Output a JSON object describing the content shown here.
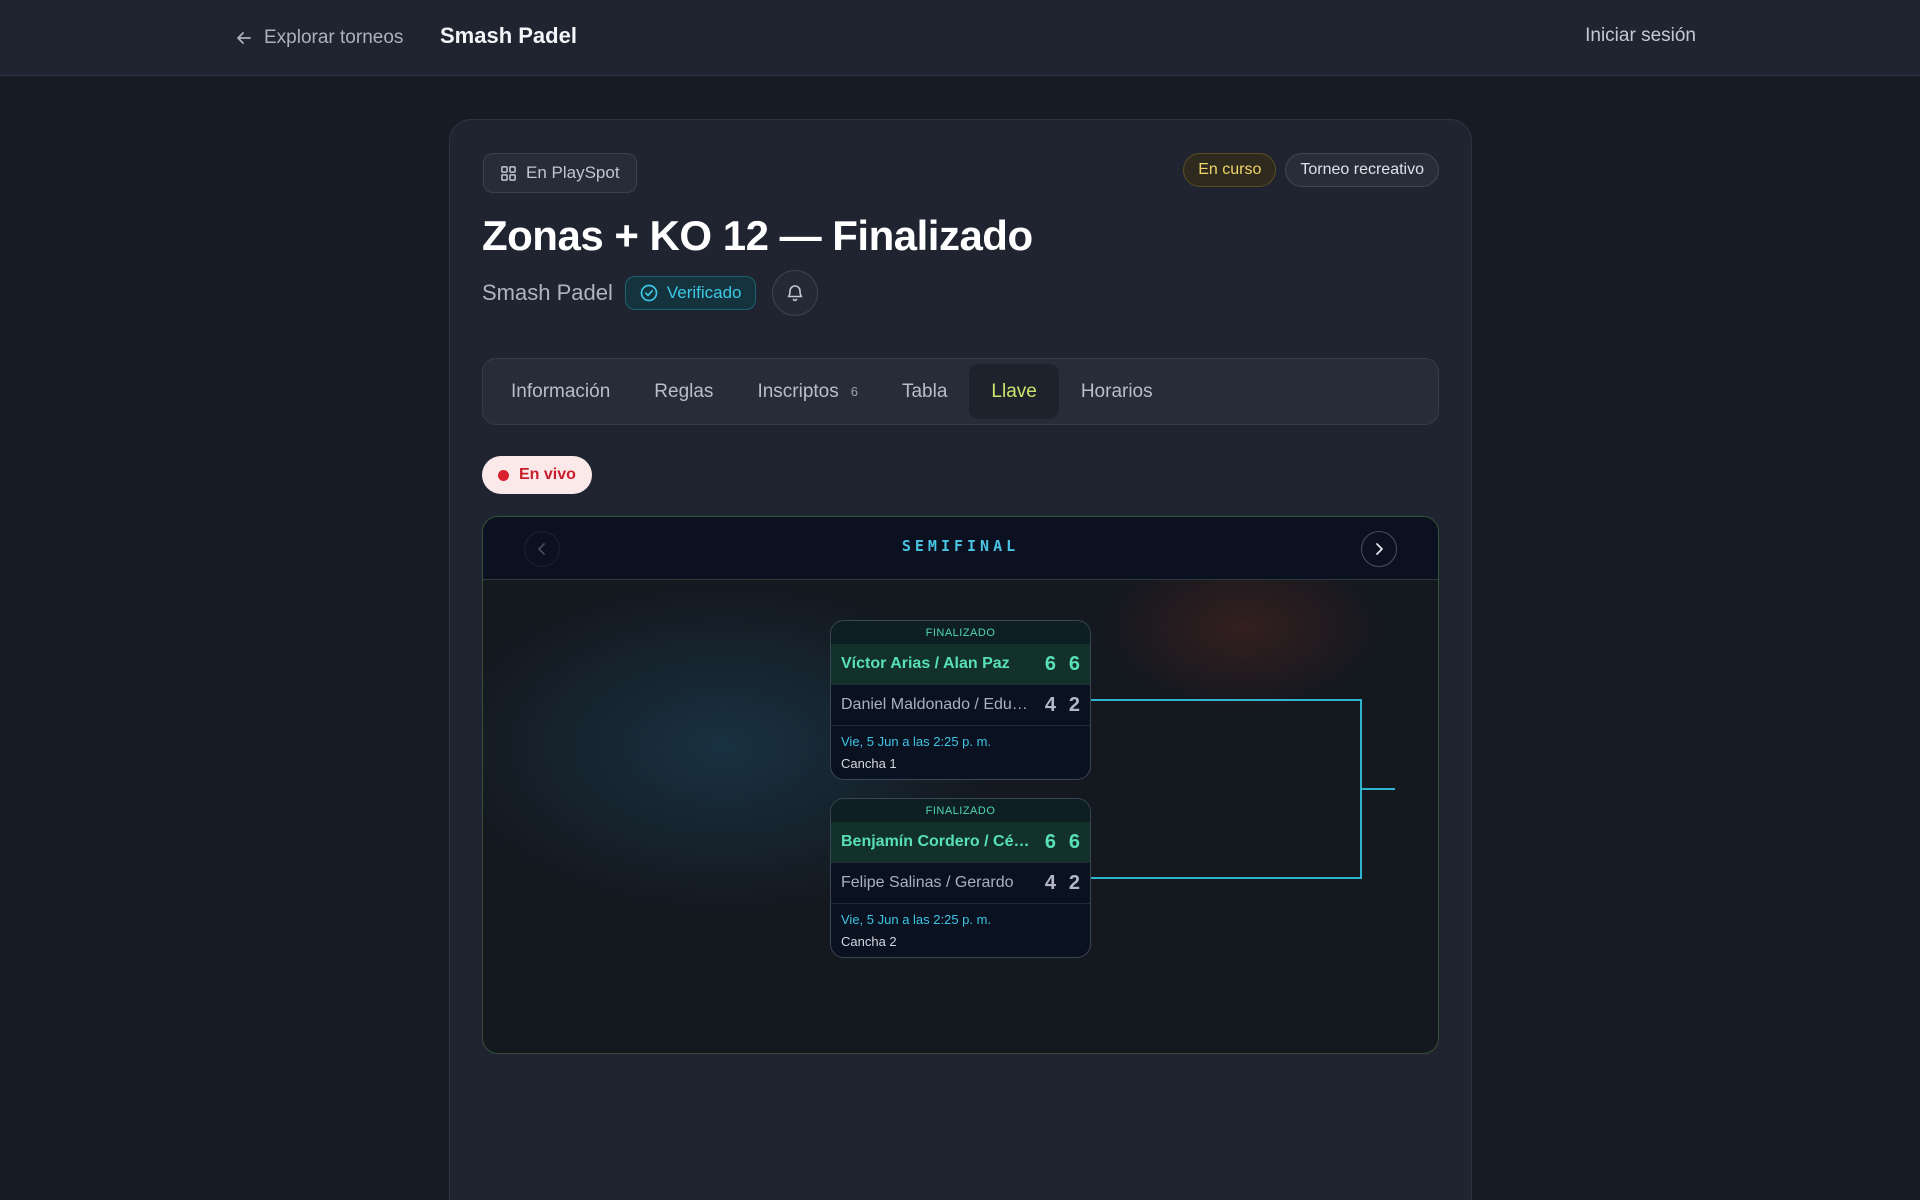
{
  "nav": {
    "back_label": "Explorar torneos",
    "brand": "Smash Padel",
    "login_label": "Iniciar sesión"
  },
  "tournament": {
    "platform_chip": "En PlaySpot",
    "status_badge": "En curso",
    "type_badge": "Torneo recreativo",
    "title": "Zonas + KO 12 — Finalizado",
    "organizer": "Smash Padel",
    "verified_label": "Verificado"
  },
  "tabs": [
    {
      "label": "Información"
    },
    {
      "label": "Reglas"
    },
    {
      "label": "Inscriptos",
      "count": "6"
    },
    {
      "label": "Tabla"
    },
    {
      "label": "Llave",
      "active": true
    },
    {
      "label": "Horarios"
    }
  ],
  "live_label": "En vivo",
  "bracket": {
    "round_title": "SEMIFINAL",
    "matches": [
      {
        "status": "FINALIZADO",
        "team1": {
          "name": "Víctor Arias / Alan Paz",
          "scores": [
            "6",
            "6"
          ],
          "winner": true
        },
        "team2": {
          "name": "Daniel Maldonado / Eduardo",
          "scores": [
            "4",
            "2"
          ],
          "winner": false
        },
        "date": "Vie, 5 Jun a las 2:25 p. m.",
        "court": "Cancha 1"
      },
      {
        "status": "FINALIZADO",
        "team1": {
          "name": "Benjamín Cordero / César",
          "scores": [
            "6",
            "6"
          ],
          "winner": true
        },
        "team2": {
          "name": "Felipe Salinas / Gerardo",
          "scores": [
            "4",
            "2"
          ],
          "winner": false
        },
        "date": "Vie, 5 Jun a las 2:25 p. m.",
        "court": "Cancha 2"
      }
    ]
  },
  "colors": {
    "accent_tab": "#c7e86d",
    "winner_green": "#58e0b6",
    "bracket_line": "#2fb3cf",
    "live_red": "#d9202e"
  }
}
